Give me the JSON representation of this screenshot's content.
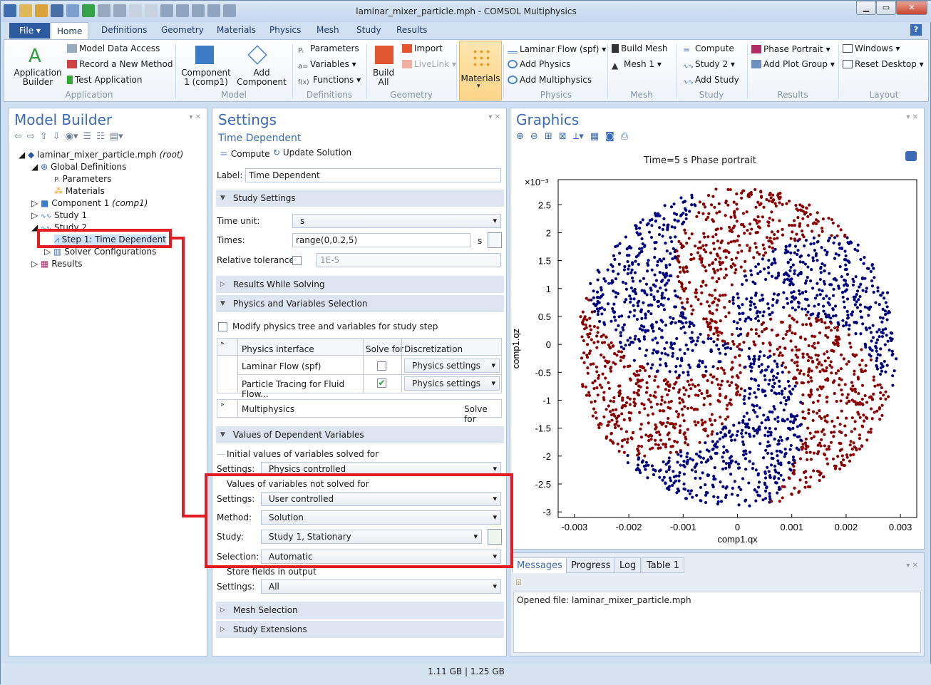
{
  "window": {
    "title": "laminar_mixer_particle.mph - COMSOL Multiphysics"
  },
  "menu": {
    "file": "File",
    "tabs": [
      "Home",
      "Definitions",
      "Geometry",
      "Materials",
      "Physics",
      "Mesh",
      "Study",
      "Results"
    ],
    "help": "?"
  },
  "ribbon": {
    "application": {
      "builder": "Application Builder",
      "model_data": "Model Data Access",
      "record": "Record a New Method",
      "test": "Test Application",
      "group": "Application"
    },
    "model": {
      "component": "Component 1 (comp1)",
      "add_component": "Add Component",
      "group": "Model"
    },
    "definitions": {
      "parameters": "Parameters",
      "variables": "Variables",
      "functions": "Functions",
      "group": "Definitions"
    },
    "geometry": {
      "build_all": "Build All",
      "import": "Import",
      "livelink": "LiveLink",
      "group": "Geometry"
    },
    "materials": {
      "label": "Materials"
    },
    "physics": {
      "laminar": "Laminar Flow (spf)",
      "add_physics": "Add Physics",
      "add_multiphysics": "Add Multiphysics",
      "group": "Physics"
    },
    "mesh": {
      "build_mesh": "Build Mesh",
      "mesh1": "Mesh 1",
      "group": "Mesh"
    },
    "study": {
      "compute": "Compute",
      "study2": "Study 2",
      "add_study": "Add Study",
      "group": "Study"
    },
    "results": {
      "phase_portrait": "Phase Portrait",
      "add_plot_group": "Add Plot Group",
      "group": "Results"
    },
    "layout": {
      "windows": "Windows",
      "reset_desktop": "Reset Desktop",
      "group": "Layout"
    }
  },
  "model_builder": {
    "title": "Model Builder",
    "tree": [
      {
        "label": "laminar_mixer_particle.mph",
        "suffix": "(root)"
      },
      {
        "label": "Global Definitions"
      },
      {
        "label": "Parameters"
      },
      {
        "label": "Materials"
      },
      {
        "label": "Component 1",
        "suffix": "(comp1)"
      },
      {
        "label": "Study 1"
      },
      {
        "label": "Study 2"
      },
      {
        "label": "Step 1: Time Dependent"
      },
      {
        "label": "Solver Configurations"
      },
      {
        "label": "Results"
      }
    ]
  },
  "settings": {
    "title": "Settings",
    "subtitle": "Time Dependent",
    "compute": "Compute",
    "update": "Update Solution",
    "label_caption": "Label:",
    "label_value": "Time Dependent",
    "study_settings": "Study Settings",
    "time_unit_caption": "Time unit:",
    "time_unit": "s",
    "times_caption": "Times:",
    "times": "range(0,0.2,5)",
    "times_unit": "s",
    "reltol_caption": "Relative tolerance:",
    "reltol": "1E-5",
    "results_while_solving": "Results While Solving",
    "phys_var_sel": "Physics and Variables Selection",
    "modify_tree": "Modify physics tree and variables for study step",
    "table_headers": [
      "Physics interface",
      "Solve for",
      "Discretization"
    ],
    "table_rows": [
      {
        "iface": "Laminar Flow (spf)",
        "solve": false,
        "disc": "Physics settings"
      },
      {
        "iface": "Particle Tracing for Fluid Flow...",
        "solve": true,
        "disc": "Physics settings"
      }
    ],
    "multiphysics": "Multiphysics",
    "multiphysics_solve": "Solve for",
    "values_dep": "Values of Dependent Variables",
    "initial_values": "Initial values of variables solved for",
    "settings_caption": "Settings:",
    "initial_setting": "Physics controlled",
    "not_solved": "Values of variables not solved for",
    "not_solved_setting": "User controlled",
    "method_caption": "Method:",
    "method": "Solution",
    "study_caption": "Study:",
    "study": "Study 1, Stationary",
    "selection_caption": "Selection:",
    "selection": "Automatic",
    "store_fields": "Store fields in output",
    "store_setting": "All",
    "mesh_selection": "Mesh Selection",
    "study_extensions": "Study Extensions"
  },
  "graphics": {
    "title": "Graphics",
    "plot_title": "Time=5 s  Phase portrait"
  },
  "messages": {
    "tabs": [
      "Messages",
      "Progress",
      "Log",
      "Table 1"
    ],
    "text": "Opened file: laminar_mixer_particle.mph"
  },
  "status": {
    "memory": "1.11 GB | 1.25 GB"
  },
  "chart_data": {
    "type": "scatter",
    "title": "Time=5 s  Phase portrait",
    "xlabel": "comp1.qx",
    "ylabel": "comp1.qz",
    "xscale": "×10⁻³",
    "yscale": "×10⁻³",
    "xlim": [
      -0.0033,
      0.0033
    ],
    "ylim": [
      -3.1,
      2.95
    ],
    "xticks": [
      "-0.003",
      "-0.002",
      "-0.001",
      "0",
      "0.001",
      "0.002",
      "0.003"
    ],
    "xtick_values": [
      -0.003,
      -0.002,
      -0.001,
      0,
      0.001,
      0.002,
      0.003
    ],
    "yticks": [
      "2.5",
      "2",
      "1.5",
      "1",
      "0.5",
      "0",
      "-0.5",
      "-1",
      "-1.5",
      "-2",
      "-2.5",
      "-3"
    ],
    "ytick_values": [
      2.5,
      2,
      1.5,
      1,
      0.5,
      0,
      -0.5,
      -1,
      -1.5,
      -2,
      -2.5,
      -3
    ],
    "series": [
      {
        "color": "#8b0000",
        "values_note": "particles"
      },
      {
        "color": "#00007f"
      }
    ],
    "colors": {
      "red": "#8b0000",
      "blue": "#00007f"
    },
    "grid": false
  }
}
